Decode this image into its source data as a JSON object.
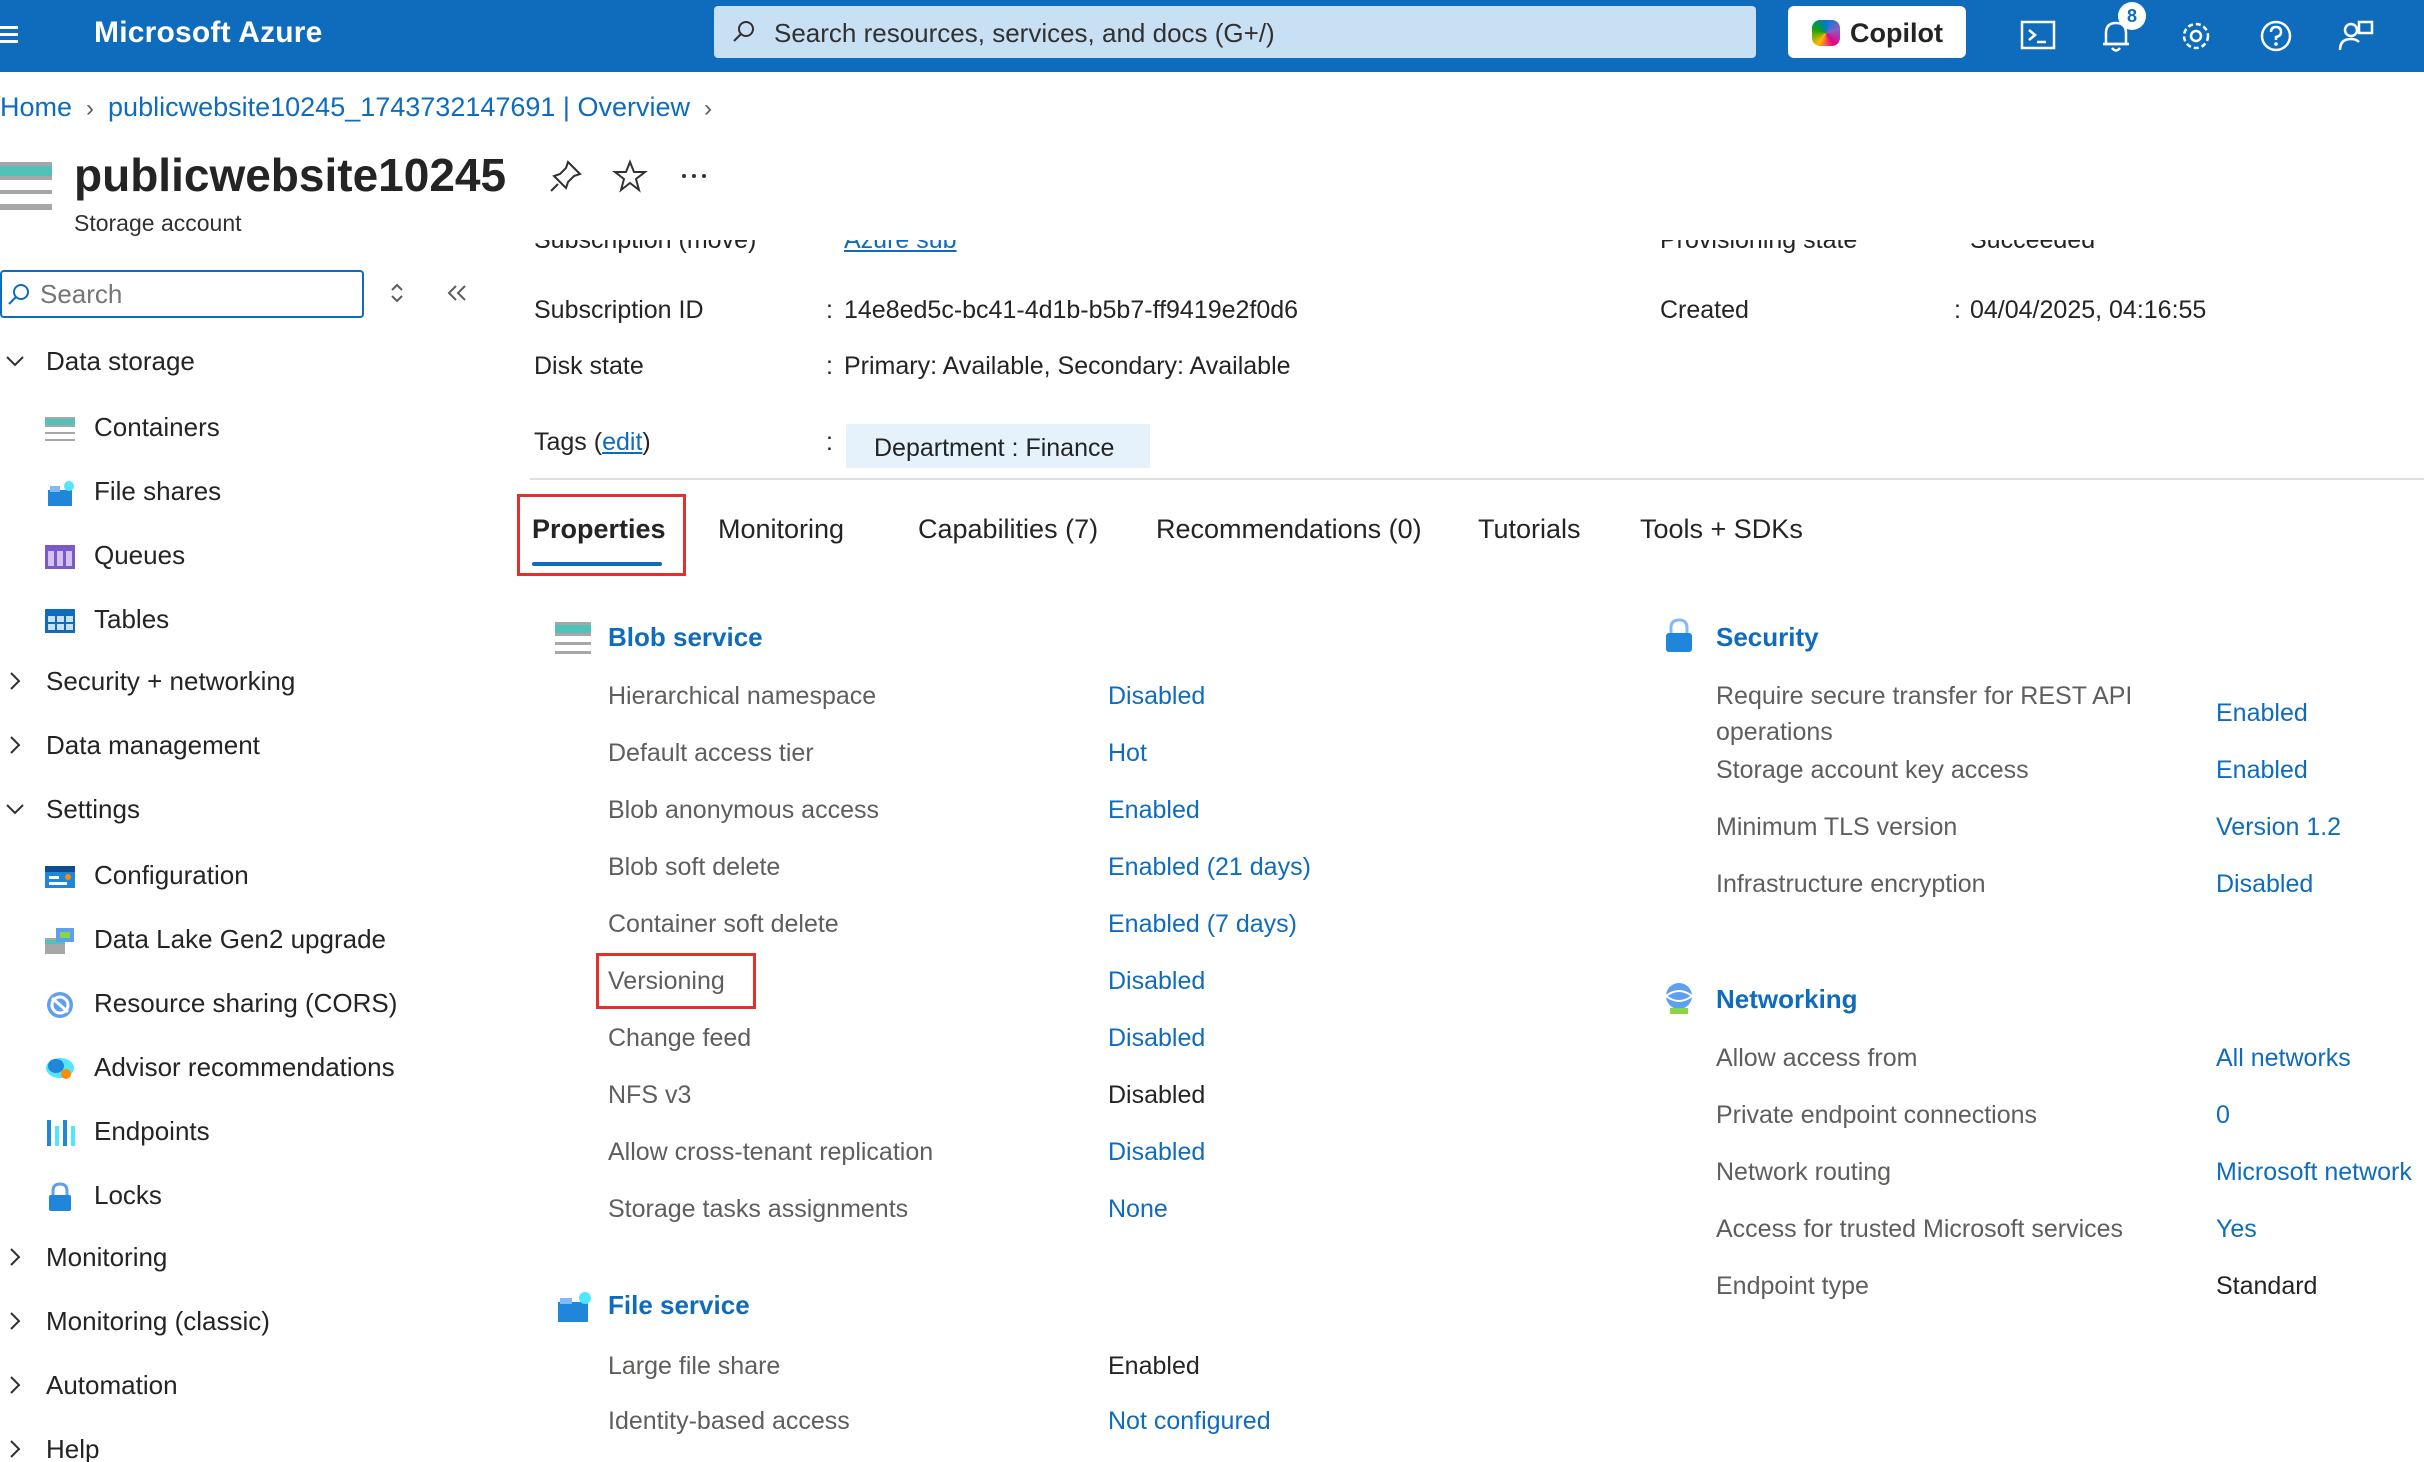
{
  "topbar": {
    "brand": "Microsoft Azure",
    "search_placeholder": "Search resources, services, and docs (G+/)",
    "copilot_label": "Copilot",
    "notification_count": "8"
  },
  "breadcrumb": {
    "home": "Home",
    "overview": "publicwebsite10245_1743732147691 | Overview"
  },
  "resource": {
    "title": "publicwebsite10245",
    "subtitle": "Storage account"
  },
  "sidebar": {
    "search_placeholder": "Search",
    "groups": [
      {
        "label": "Data storage",
        "expanded": true
      },
      {
        "label": "Security + networking",
        "expanded": false
      },
      {
        "label": "Data management",
        "expanded": false
      },
      {
        "label": "Settings",
        "expanded": true
      },
      {
        "label": "Monitoring",
        "expanded": false
      },
      {
        "label": "Monitoring (classic)",
        "expanded": false
      },
      {
        "label": "Automation",
        "expanded": false
      },
      {
        "label": "Help",
        "expanded": false
      }
    ],
    "data_storage_items": [
      "Containers",
      "File shares",
      "Queues",
      "Tables"
    ],
    "settings_items": [
      "Configuration",
      "Data Lake Gen2 upgrade",
      "Resource sharing (CORS)",
      "Advisor recommendations",
      "Endpoints",
      "Locks"
    ]
  },
  "essentials": {
    "clipped_left_label": "Subscription (move)",
    "clipped_left_value": "Azure sub",
    "clipped_right_label": "Provisioning state",
    "clipped_right_value": "Succeeded",
    "subscription_id_label": "Subscription ID",
    "subscription_id_value": "14e8ed5c-bc41-4d1b-b5b7-ff9419e2f0d6",
    "disk_state_label": "Disk state",
    "disk_state_value": "Primary: Available, Secondary: Available",
    "created_label": "Created",
    "created_value": "04/04/2025, 04:16:55",
    "tags_label": "Tags (",
    "tags_edit": "edit",
    "tags_close": ")",
    "tag_value": "Department : Finance",
    "colon": ":"
  },
  "tabs": [
    "Properties",
    "Monitoring",
    "Capabilities (7)",
    "Recommendations (0)",
    "Tutorials",
    "Tools + SDKs"
  ],
  "blob_service": {
    "title": "Blob service",
    "rows": [
      {
        "label": "Hierarchical namespace",
        "value": "Disabled",
        "link": true
      },
      {
        "label": "Default access tier",
        "value": "Hot",
        "link": true
      },
      {
        "label": "Blob anonymous access",
        "value": "Enabled",
        "link": true
      },
      {
        "label": "Blob soft delete",
        "value": "Enabled (21 days)",
        "link": true
      },
      {
        "label": "Container soft delete",
        "value": "Enabled (7 days)",
        "link": true
      },
      {
        "label": "Versioning",
        "value": "Disabled",
        "link": true
      },
      {
        "label": "Change feed",
        "value": "Disabled",
        "link": true
      },
      {
        "label": "NFS v3",
        "value": "Disabled",
        "link": false
      },
      {
        "label": "Allow cross-tenant replication",
        "value": "Disabled",
        "link": true
      },
      {
        "label": "Storage tasks assignments",
        "value": "None",
        "link": true
      }
    ]
  },
  "file_service": {
    "title": "File service",
    "rows": [
      {
        "label": "Large file share",
        "value": "Enabled",
        "link": false
      },
      {
        "label": "Identity-based access",
        "value": "Not configured",
        "link": true
      }
    ]
  },
  "security": {
    "title": "Security",
    "rows": [
      {
        "label": "Require secure transfer for REST API",
        "label2": "operations",
        "value": "Enabled",
        "link": true
      },
      {
        "label": "Storage account key access",
        "value": "Enabled",
        "link": true
      },
      {
        "label": "Minimum TLS version",
        "value": "Version 1.2",
        "link": true
      },
      {
        "label": "Infrastructure encryption",
        "value": "Disabled",
        "link": true
      }
    ]
  },
  "networking": {
    "title": "Networking",
    "rows": [
      {
        "label": "Allow access from",
        "value": "All networks",
        "link": true
      },
      {
        "label": "Private endpoint connections",
        "value": "0",
        "link": true
      },
      {
        "label": "Network routing",
        "value": "Microsoft network",
        "link": true
      },
      {
        "label": "Access for trusted Microsoft services",
        "value": "Yes",
        "link": true
      },
      {
        "label": "Endpoint type",
        "value": "Standard",
        "link": false
      }
    ]
  }
}
